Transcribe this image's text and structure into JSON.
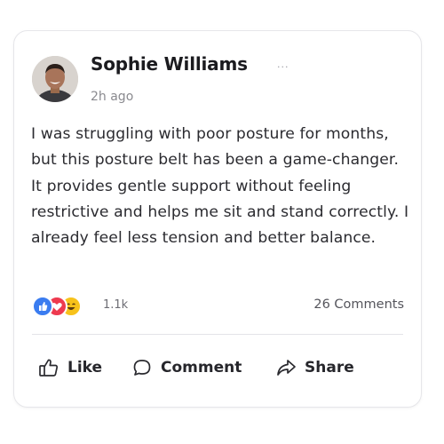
{
  "post": {
    "author": "Sophie Williams",
    "time": "2h ago",
    "more_icon": "more-horizontal-icon",
    "text": "I was struggling with poor posture for months, but this posture belt has been a game-changer. It provides gentle support without feeling restrictive and helps me sit and stand correctly. I already feel less tension and better balance."
  },
  "stats": {
    "reactions": [
      "like",
      "love",
      "haha"
    ],
    "reaction_count": "1.1k",
    "comments": "26 Comments"
  },
  "actions": {
    "like": "Like",
    "comment": "Comment",
    "share": "Share"
  },
  "colors": {
    "like_reaction": "#3a7cf0",
    "love_reaction": "#ee3a4f",
    "haha_reaction": "#f7c21b",
    "text": "#2b2b30"
  }
}
